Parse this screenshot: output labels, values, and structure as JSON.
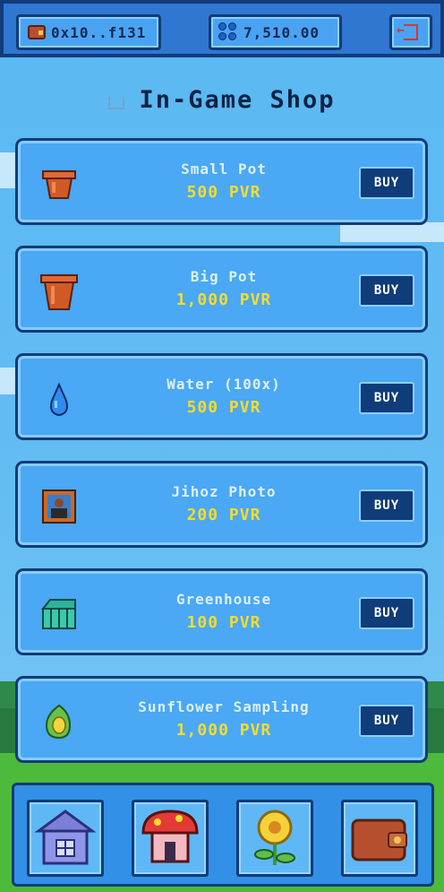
{
  "header": {
    "wallet_address": "0x10..f131",
    "balance": "7,510.00",
    "wallet_icon": "wallet-icon",
    "currency_icon": "clover-icon",
    "exit_icon": "logout-icon"
  },
  "shop": {
    "title": "In-Game Shop",
    "buy_label": "BUY",
    "items": [
      {
        "name": "Small Pot",
        "price": "500 PVR",
        "icon": "small-pot-icon"
      },
      {
        "name": "Big Pot",
        "price": "1,000 PVR",
        "icon": "big-pot-icon"
      },
      {
        "name": "Water (100x)",
        "price": "500 PVR",
        "icon": "water-drop-icon"
      },
      {
        "name": "Jihoz Photo",
        "price": "200 PVR",
        "icon": "photo-frame-icon"
      },
      {
        "name": "Greenhouse",
        "price": "100 PVR",
        "icon": "greenhouse-icon"
      },
      {
        "name": "Sunflower Sampling",
        "price": "1,000 PVR",
        "icon": "sunflower-seedling-icon"
      }
    ]
  },
  "bottom_nav": [
    {
      "icon": "house-icon"
    },
    {
      "icon": "shop-icon"
    },
    {
      "icon": "sunflower-icon"
    },
    {
      "icon": "wallet-icon"
    }
  ],
  "colors": {
    "sky": "#5bb8f2",
    "card": "#4aa8f4",
    "border": "#123b78",
    "price": "#f7dc2d",
    "buy_button": "#103c7a"
  }
}
